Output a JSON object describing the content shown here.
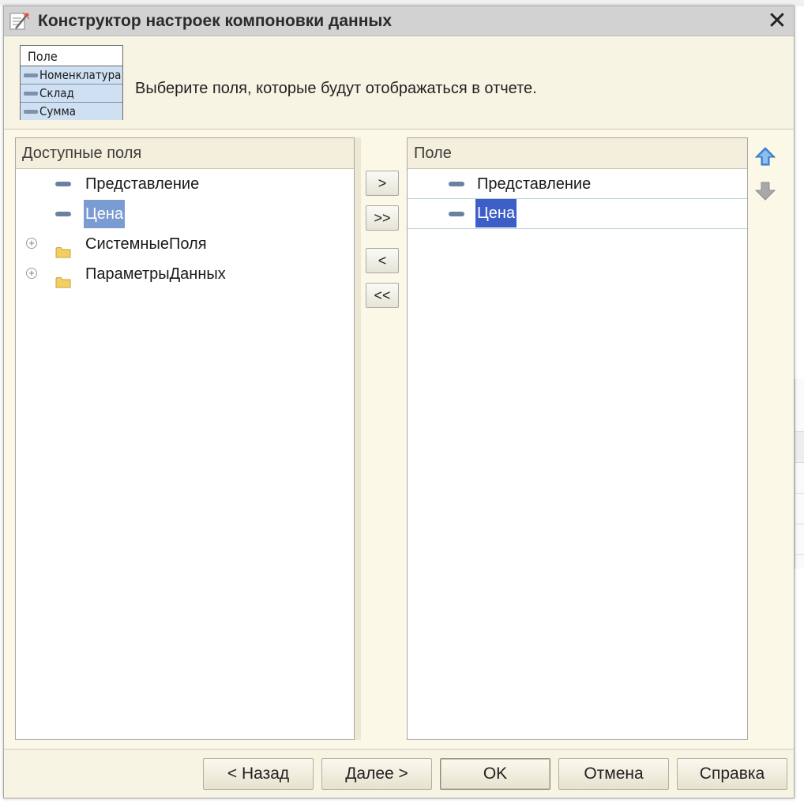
{
  "dialog": {
    "title": "Конструктор настроек компоновки данных",
    "close_symbol": "✕",
    "instruction": "Выберите поля, которые будут отображаться в отчете."
  },
  "illustration": {
    "header": "Поле",
    "rows": [
      "Номенклатура",
      "Склад",
      "Сумма"
    ]
  },
  "available": {
    "header": "Доступные поля",
    "items": [
      {
        "label": "Представление",
        "icon": "field-icon",
        "expandable": false,
        "selected": false
      },
      {
        "label": "Цена",
        "icon": "field-icon",
        "expandable": false,
        "selected": true
      },
      {
        "label": "СистемныеПоля",
        "icon": "folder-icon",
        "expandable": true,
        "selected": false
      },
      {
        "label": "ПараметрыДанных",
        "icon": "folder-icon",
        "expandable": true,
        "selected": false
      }
    ]
  },
  "move_buttons": {
    "add": ">",
    "add_all": ">>",
    "remove": "<",
    "remove_all": "<<"
  },
  "selected": {
    "header": "Поле",
    "items": [
      {
        "label": "Представление",
        "icon": "field-icon",
        "selected": false
      },
      {
        "label": "Цена",
        "icon": "field-icon",
        "selected": true
      }
    ]
  },
  "order_buttons": {
    "up_icon": "arrow-up-icon",
    "down_icon": "arrow-down-icon"
  },
  "footer": {
    "back": "< Назад",
    "next": "Далее >",
    "ok": "OK",
    "cancel": "Отмена",
    "help": "Справка"
  },
  "colors": {
    "dialog_bg": "#fbf8e8",
    "title_bar": "#d2d2d2",
    "selection_light": "#7a9cd3",
    "selection_dark": "#3d5ec7",
    "field_icon": "#6b81a0",
    "folder_icon": "#f2cf63",
    "up_arrow": "#4a8fd8",
    "down_arrow": "#a8a8a8"
  }
}
